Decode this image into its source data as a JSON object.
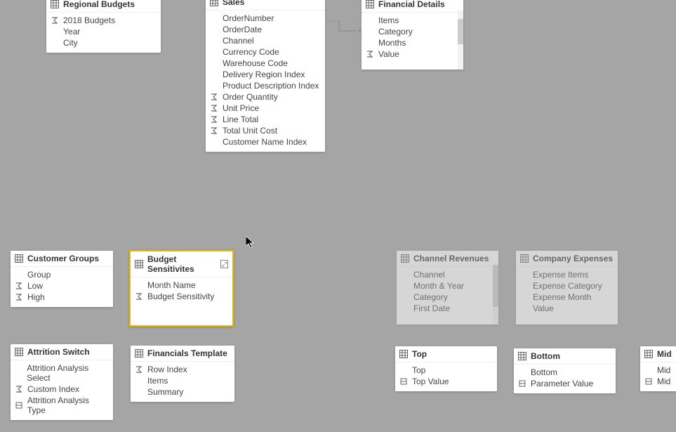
{
  "tables": {
    "regionalBudgets": {
      "title": "Regional Budgets",
      "fields": [
        {
          "label": "2018 Budgets",
          "icon": "sigma"
        },
        {
          "label": "Year",
          "icon": null
        },
        {
          "label": "City",
          "icon": null
        }
      ]
    },
    "sales": {
      "title": "Sales",
      "fields": [
        {
          "label": "OrderNumber",
          "icon": null
        },
        {
          "label": "OrderDate",
          "icon": null
        },
        {
          "label": "Channel",
          "icon": null
        },
        {
          "label": "Currency Code",
          "icon": null
        },
        {
          "label": "Warehouse Code",
          "icon": null
        },
        {
          "label": "Delivery Region Index",
          "icon": null
        },
        {
          "label": "Product Description Index",
          "icon": null
        },
        {
          "label": "Order Quantity",
          "icon": "sigma"
        },
        {
          "label": "Unit Price",
          "icon": "sigma"
        },
        {
          "label": "Line Total",
          "icon": "sigma"
        },
        {
          "label": "Total Unit Cost",
          "icon": "sigma"
        },
        {
          "label": "Customer Name Index",
          "icon": null
        }
      ]
    },
    "financialDetails": {
      "title": "Financial Details",
      "fields": [
        {
          "label": "Items",
          "icon": null
        },
        {
          "label": "Category",
          "icon": null
        },
        {
          "label": "Months",
          "icon": null
        },
        {
          "label": "Value",
          "icon": "sigma"
        }
      ]
    },
    "customerGroups": {
      "title": "Customer Groups",
      "fields": [
        {
          "label": "Group",
          "icon": null
        },
        {
          "label": "Low",
          "icon": "sigma"
        },
        {
          "label": "High",
          "icon": "sigma"
        }
      ]
    },
    "budgetSensitivities": {
      "title": "Budget Sensitivites",
      "fields": [
        {
          "label": "Month Name",
          "icon": null
        },
        {
          "label": "Budget Sensitivity",
          "icon": "sigma"
        }
      ]
    },
    "channelRevenues": {
      "title": "Channel Revenues",
      "fields": [
        {
          "label": "Channel",
          "icon": null
        },
        {
          "label": "Month & Year",
          "icon": null
        },
        {
          "label": "Category",
          "icon": null
        },
        {
          "label": "First Date",
          "icon": null
        }
      ]
    },
    "companyExpenses": {
      "title": "Company Expenses",
      "fields": [
        {
          "label": "Expense Items",
          "icon": null
        },
        {
          "label": "Expense Category",
          "icon": null
        },
        {
          "label": "Expense Month",
          "icon": null
        },
        {
          "label": "Value",
          "icon": null
        }
      ]
    },
    "attritionSwitch": {
      "title": "Attrition Switch",
      "fields": [
        {
          "label": "Attrition Analysis Select",
          "icon": null
        },
        {
          "label": "Custom Index",
          "icon": "sigma"
        },
        {
          "label": "Attrition Analysis Type",
          "icon": "param"
        }
      ]
    },
    "financialsTemplate": {
      "title": "Financials Template",
      "fields": [
        {
          "label": "Row Index",
          "icon": "sigma"
        },
        {
          "label": "Items",
          "icon": null
        },
        {
          "label": "Summary",
          "icon": null
        }
      ]
    },
    "top": {
      "title": "Top",
      "fields": [
        {
          "label": "Top",
          "icon": null
        },
        {
          "label": "Top Value",
          "icon": "param"
        }
      ]
    },
    "bottom": {
      "title": "Bottom",
      "fields": [
        {
          "label": "Bottom",
          "icon": null
        },
        {
          "label": "Parameter Value",
          "icon": "param"
        }
      ]
    },
    "mid": {
      "title": "Mid",
      "fields": [
        {
          "label": "Mid",
          "icon": null
        },
        {
          "label": "Mid",
          "icon": "param"
        }
      ]
    }
  }
}
